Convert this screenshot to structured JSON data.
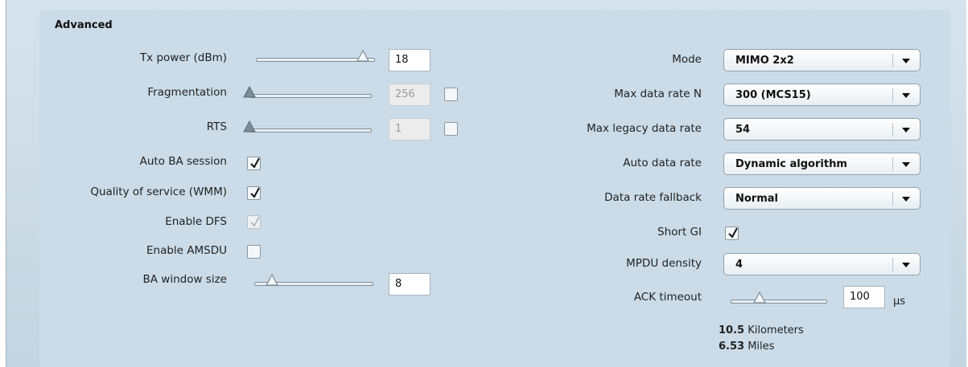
{
  "section": {
    "title": "Advanced"
  },
  "left": {
    "tx_power": {
      "label": "Tx power (dBm)",
      "value": "18",
      "slider_fraction": 0.9
    },
    "fragmentation": {
      "label": "Fragmentation",
      "value": "256",
      "enabled": false,
      "checked": false,
      "slider_fraction": 0.0
    },
    "rts": {
      "label": "RTS",
      "value": "1",
      "enabled": false,
      "checked": false,
      "slider_fraction": 0.0
    },
    "auto_ba_session": {
      "label": "Auto BA session",
      "checked": true
    },
    "wmm": {
      "label": "Quality of service (WMM)",
      "checked": true
    },
    "enable_dfs": {
      "label": "Enable DFS",
      "checked": true,
      "enabled": false
    },
    "enable_amsdu": {
      "label": "Enable AMSDU",
      "checked": false
    },
    "ba_window_size": {
      "label": "BA window size",
      "value": "8",
      "slider_fraction": 0.15
    }
  },
  "right": {
    "mode": {
      "label": "Mode",
      "value": "MIMO 2x2"
    },
    "max_rate_n": {
      "label": "Max data rate N",
      "value": "300 (MCS15)"
    },
    "max_legacy_rate": {
      "label": "Max legacy data rate",
      "value": "54"
    },
    "auto_rate": {
      "label": "Auto data rate",
      "value": "Dynamic algorithm"
    },
    "rate_fallback": {
      "label": "Data rate fallback",
      "value": "Normal"
    },
    "short_gi": {
      "label": "Short GI",
      "checked": true
    },
    "mpdu_density": {
      "label": "MPDU density",
      "value": "4"
    },
    "ack_timeout": {
      "label": "ACK timeout",
      "value": "100",
      "unit": "μs",
      "slider_fraction": 0.3
    },
    "distance": {
      "km_value": "10.5",
      "km_unit": "Kilometers",
      "mi_value": "6.53",
      "mi_unit": "Miles"
    }
  },
  "icons": {
    "dropdown": "chevron-down-icon",
    "check": "check-icon",
    "slider_thumb": "slider-thumb-icon"
  },
  "colors": {
    "panel_bg": "#cbdce8",
    "border": "#8fa1ae"
  }
}
